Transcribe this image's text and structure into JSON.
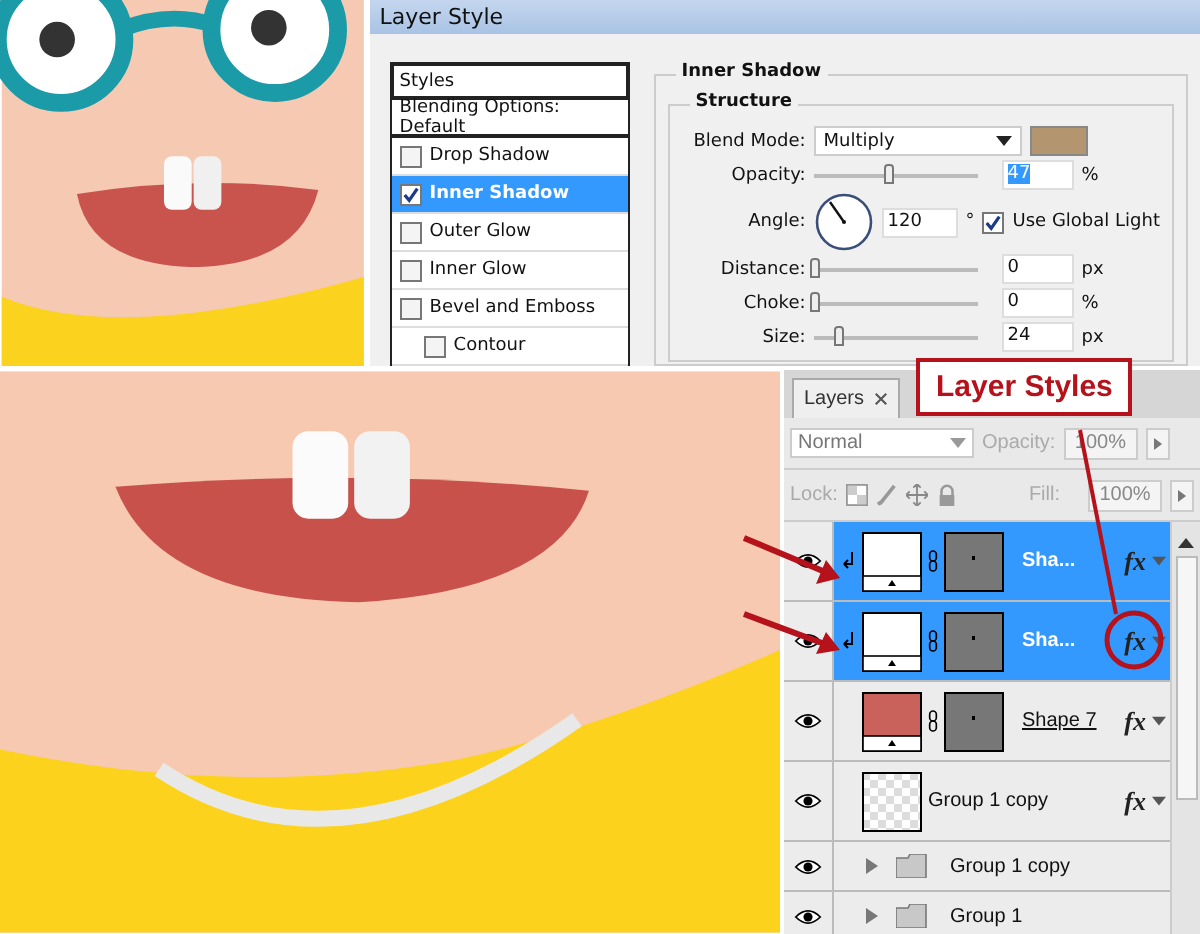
{
  "dialog": {
    "title": "Layer Style",
    "styles_header": "Styles",
    "style_items": [
      {
        "kind": "header",
        "label": "Blending Options: Default",
        "selected": false
      },
      {
        "kind": "checkbox",
        "label": "Drop Shadow",
        "checked": false,
        "selected": false
      },
      {
        "kind": "checkbox",
        "label": "Inner Shadow",
        "checked": true,
        "selected": true
      },
      {
        "kind": "checkbox",
        "label": "Outer Glow",
        "checked": false,
        "selected": false
      },
      {
        "kind": "checkbox",
        "label": "Inner Glow",
        "checked": false,
        "selected": false
      },
      {
        "kind": "checkbox",
        "label": "Bevel and Emboss",
        "checked": false,
        "selected": false,
        "children": [
          {
            "kind": "checkbox",
            "label": "Contour",
            "checked": false,
            "selected": false
          }
        ]
      }
    ],
    "section_title": "Inner Shadow",
    "group_title": "Structure",
    "blend_mode": {
      "label": "Blend Mode:",
      "value": "Multiply"
    },
    "angle": {
      "label": "Angle:",
      "value": "120",
      "unit": "°"
    },
    "global_light": {
      "label": "Use Global Light",
      "checked": true
    },
    "sliders": [
      {
        "label": "Opacity:",
        "level": 0.45,
        "value": "47",
        "unit": "%",
        "selected": true
      },
      {
        "kind": "gap"
      },
      {
        "label": "Distance:",
        "level": 0,
        "value": "0",
        "unit": "px",
        "selected": false
      },
      {
        "label": "Choke:",
        "level": 0,
        "value": "0",
        "unit": "%",
        "selected": false
      },
      {
        "label": "Size:",
        "level": 0.15,
        "value": "24",
        "unit": "px",
        "selected": false
      }
    ]
  },
  "layers_panel": {
    "tabs": [
      {
        "label": "Layers",
        "selected": true
      }
    ],
    "blend_mode": "Normal",
    "opacity_label": "Opacity:",
    "opacity_value": "100%",
    "lock_label": "Lock:",
    "fill_label": "Fill:",
    "fill_value": "100%",
    "layers": [
      {
        "name": "Sha...",
        "kind": "white-shape",
        "selected": true,
        "clipped": true,
        "fx": "fx",
        "mask": true,
        "underline": false
      },
      {
        "name": "Sha...",
        "kind": "white-shape",
        "selected": true,
        "clipped": true,
        "fx": "fx",
        "mask": true,
        "underline": false
      },
      {
        "name": "Shape 7",
        "kind": "red-shape",
        "selected": false,
        "clipped": false,
        "fx": "fx",
        "mask": true,
        "underline": true
      },
      {
        "name": "Group 1 copy",
        "kind": "transparent",
        "selected": false,
        "clipped": false,
        "fx": "fx",
        "mask": false,
        "underline": false
      },
      {
        "name": "Group 1 copy",
        "kind": "folder",
        "selected": false,
        "clipped": false,
        "mask": false,
        "underline": false
      },
      {
        "name": "Group 1",
        "kind": "folder",
        "selected": false,
        "clipped": false,
        "mask": false,
        "underline": false
      }
    ]
  },
  "callout": {
    "label": "Layer Styles"
  }
}
